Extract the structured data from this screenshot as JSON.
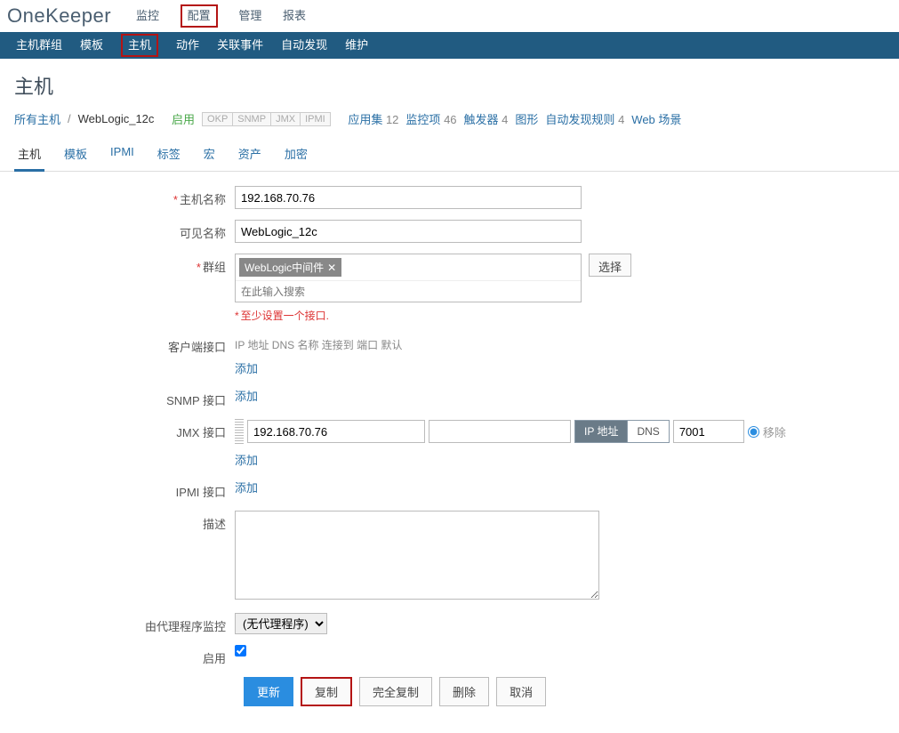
{
  "brand": "OneKeeper",
  "topnav": {
    "monitor": "监控",
    "config": "配置",
    "manage": "管理",
    "report": "报表"
  },
  "subnav": {
    "hostgroup": "主机群组",
    "template": "模板",
    "host": "主机",
    "action": "动作",
    "event": "关联事件",
    "discovery": "自动发现",
    "maintain": "维护"
  },
  "page_title": "主机",
  "crumbs": {
    "all_hosts": "所有主机",
    "host": "WebLogic_12c",
    "enabled": "启用",
    "tags": [
      "OKP",
      "SNMP",
      "JMX",
      "IPMI"
    ],
    "apps": "应用集",
    "apps_n": "12",
    "items": "监控项",
    "items_n": "46",
    "triggers": "触发器",
    "triggers_n": "4",
    "graphs": "图形",
    "disc": "自动发现规则",
    "disc_n": "4",
    "web": "Web 场景"
  },
  "tabs": {
    "host": "主机",
    "template": "模板",
    "ipmi": "IPMI",
    "tag": "标签",
    "macro": "宏",
    "asset": "资产",
    "encrypt": "加密"
  },
  "labels": {
    "hostname": "主机名称",
    "visible": "可见名称",
    "groups": "群组",
    "group_chip": "WebLogic中间件",
    "group_search_ph": "在此输入搜索",
    "select": "选择",
    "iface_note": "至少设置一个接口.",
    "client_iface": "客户端接口",
    "iface_headers": "IP 地址 DNS 名称 连接到 端口 默认",
    "add": "添加",
    "snmp_iface": "SNMP 接口",
    "jmx_iface": "JMX 接口",
    "ipmi_iface": "IPMI 接口",
    "desc": "描述",
    "proxy": "由代理程序监控",
    "enable": "启用",
    "remove": "移除",
    "ip_seg": "IP 地址",
    "dns_seg": "DNS"
  },
  "values": {
    "hostname": "192.168.70.76",
    "visible": "WebLogic_12c",
    "jmx_ip": "192.168.70.76",
    "jmx_dns": "",
    "jmx_port": "7001",
    "proxy_option": "(无代理程序)"
  },
  "buttons": {
    "update": "更新",
    "clone": "复制",
    "fullclone": "完全复制",
    "delete": "删除",
    "cancel": "取消"
  }
}
